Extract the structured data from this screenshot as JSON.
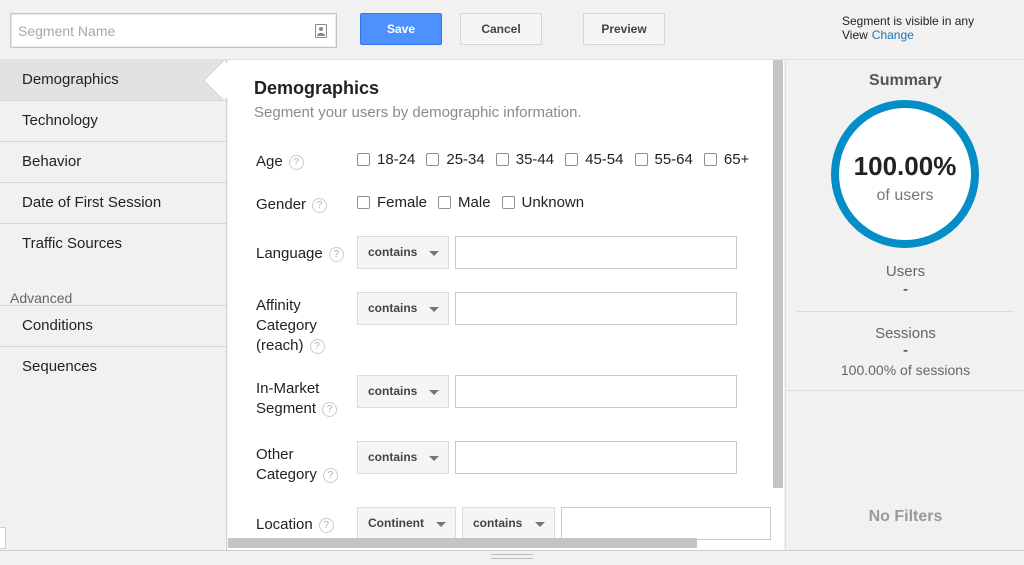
{
  "header": {
    "segment_name_placeholder": "Segment Name",
    "save_label": "Save",
    "cancel_label": "Cancel",
    "preview_label": "Preview",
    "visibility_text": "Segment is visible in any View",
    "change_link": "Change"
  },
  "sidebar": {
    "items": [
      {
        "label": "Demographics",
        "active": true
      },
      {
        "label": "Technology"
      },
      {
        "label": "Behavior"
      },
      {
        "label": "Date of First Session"
      },
      {
        "label": "Traffic Sources"
      }
    ],
    "advanced_heading": "Advanced",
    "advanced_items": [
      {
        "label": "Conditions"
      },
      {
        "label": "Sequences"
      }
    ]
  },
  "main": {
    "title": "Demographics",
    "subtitle": "Segment your users by demographic information.",
    "help_glyph": "?",
    "age": {
      "label": "Age",
      "options": [
        "18-24",
        "25-34",
        "35-44",
        "45-54",
        "55-64",
        "65+"
      ]
    },
    "gender": {
      "label": "Gender",
      "options": [
        "Female",
        "Male",
        "Unknown"
      ]
    },
    "language": {
      "label": "Language",
      "operator": "contains",
      "value": ""
    },
    "affinity": {
      "label_1": "Affinity",
      "label_2": "Category",
      "label_3": "(reach)",
      "operator": "contains",
      "value": ""
    },
    "in_market": {
      "label_1": "In-Market",
      "label_2": "Segment",
      "operator": "contains",
      "value": ""
    },
    "other": {
      "label_1": "Other",
      "label_2": "Category",
      "operator": "contains",
      "value": ""
    },
    "location": {
      "label": "Location",
      "scope": "Continent",
      "operator": "contains",
      "value": ""
    }
  },
  "summary": {
    "title": "Summary",
    "percent": "100.00%",
    "percent_label": "of users",
    "users_label": "Users",
    "users_value": "-",
    "sessions_label": "Sessions",
    "sessions_value": "-",
    "sessions_detail": "100.00% of sessions",
    "no_filters": "No Filters",
    "ring_color": "#058dc7"
  },
  "colors": {
    "primary_button": "#4d90fe",
    "link": "#1a73b8"
  }
}
